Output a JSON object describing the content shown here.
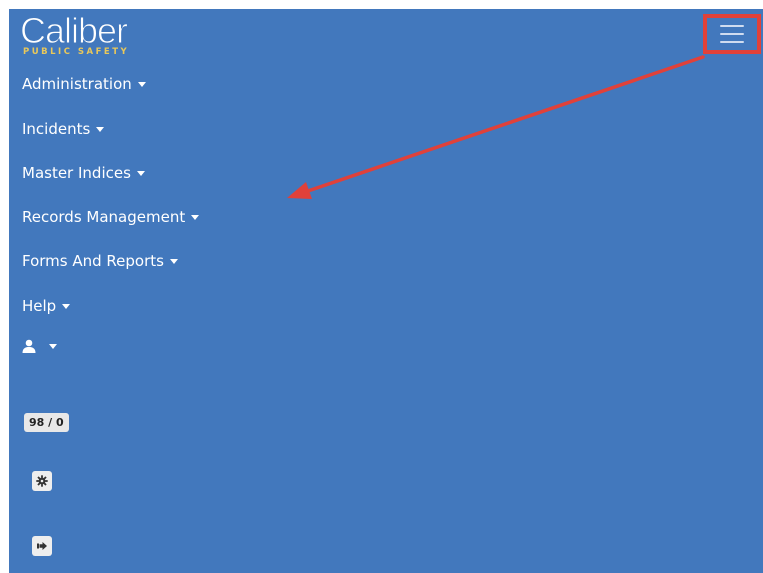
{
  "brand": {
    "logo_word": "Caliber",
    "logo_sub": "PUBLIC SAFETY"
  },
  "menu": {
    "items": [
      {
        "label": "Administration"
      },
      {
        "label": "Incidents"
      },
      {
        "label": "Master Indices"
      },
      {
        "label": "Records Management"
      },
      {
        "label": "Forms And Reports"
      },
      {
        "label": "Help"
      }
    ]
  },
  "counter_badge": "98 / 0",
  "icons": {
    "menu": "hamburger-menu-icon",
    "user": "user-icon",
    "settings": "gear-icon",
    "logout": "sign-out-icon",
    "annotation": "arrow-annotation"
  },
  "colors": {
    "nav_background": "#4278bd",
    "highlight": "#e0413a",
    "logo_sub": "#e9c85a"
  }
}
